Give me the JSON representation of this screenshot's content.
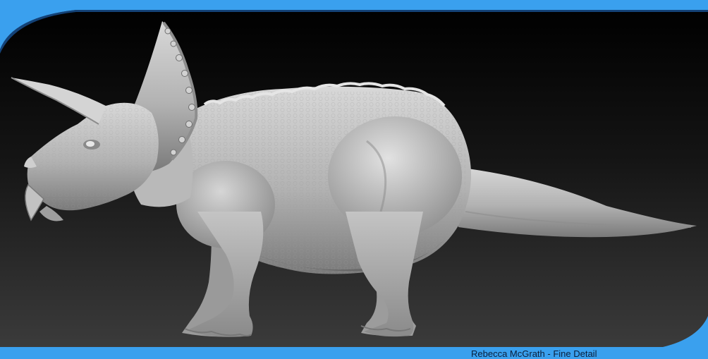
{
  "caption": "Rebecca McGrath - Fine Detail",
  "subject_icon": "triceratops-sculpt",
  "colors": {
    "frame_blue": "#3aa0ee",
    "frame_dark_blue": "#1f6cc4",
    "viewport_top": "#000000",
    "viewport_bottom": "#3b3b3b",
    "sculpt_light": "#c9c9c9",
    "sculpt_shadow": "#6e6e6e"
  }
}
